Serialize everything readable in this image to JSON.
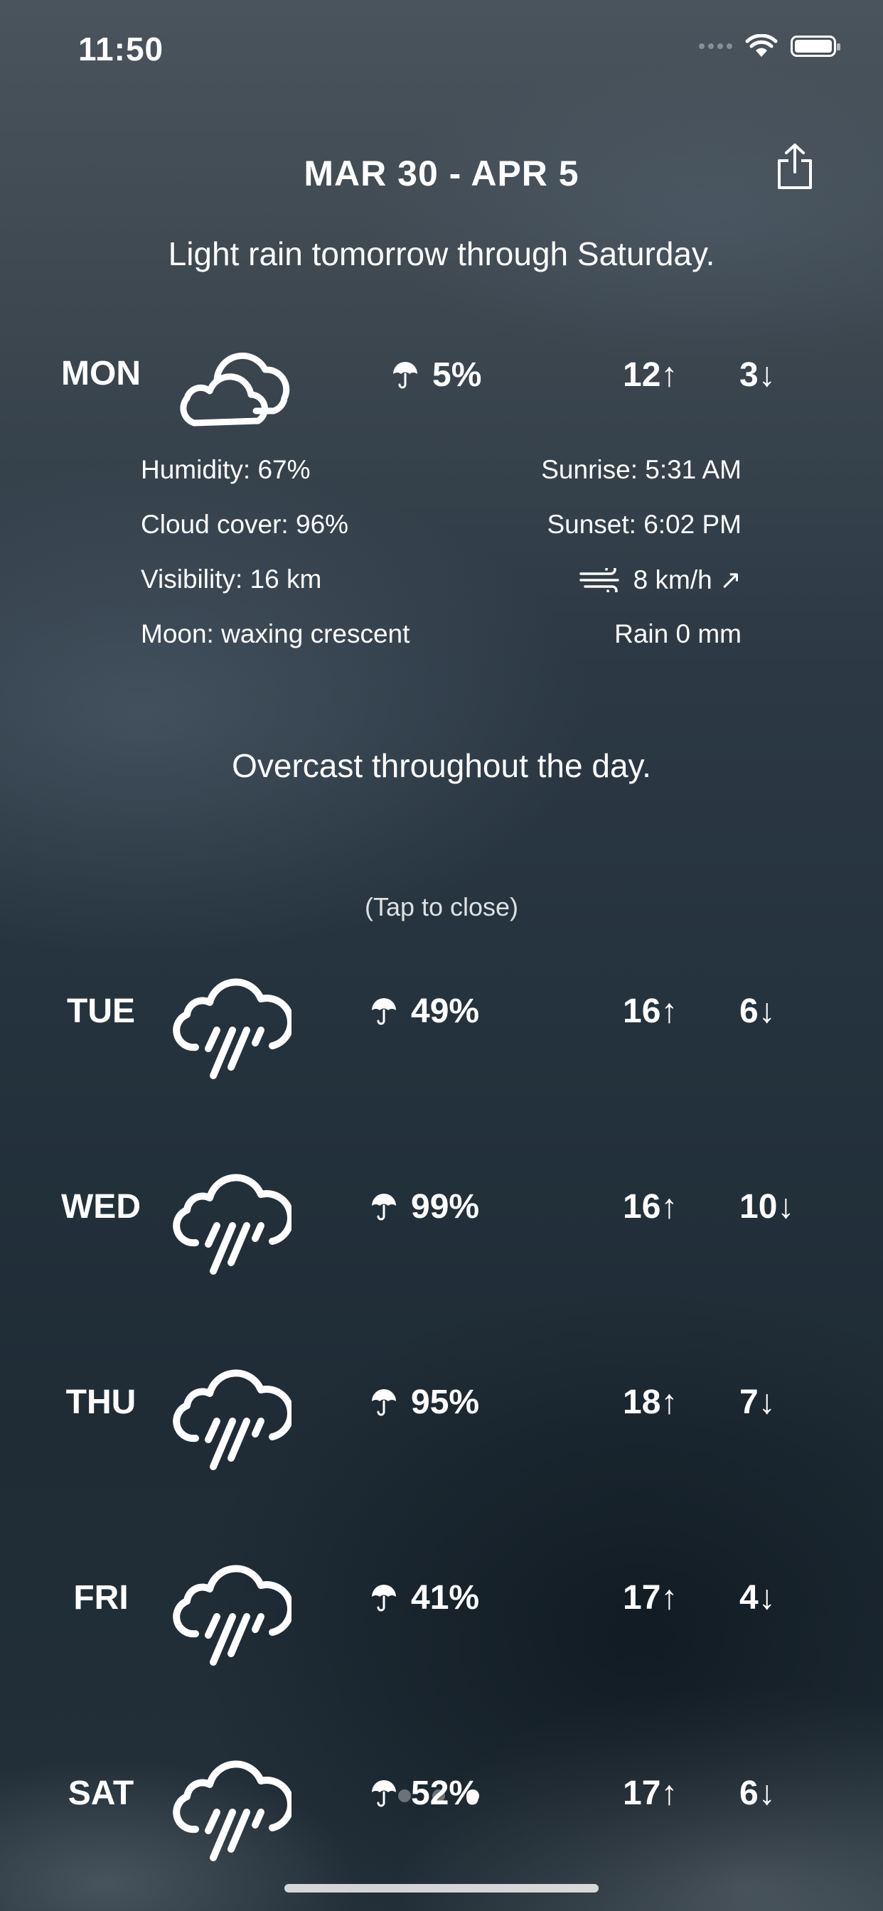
{
  "status": {
    "time": "11:50"
  },
  "header": {
    "date_range": "MAR 30 - APR 5"
  },
  "summary": "Light rain tomorrow through Saturday.",
  "expanded_day": {
    "day": "MON",
    "icon": "cloud-icon",
    "precip": "5%",
    "high": "12↑",
    "low": "3↓",
    "details_left": [
      "Humidity: 67%",
      "Cloud cover: 96%",
      "Visibility: 16 km",
      "Moon: waxing crescent"
    ],
    "details_right": [
      "Sunrise: 5:31 AM",
      "Sunset: 6:02 PM",
      "8 km/h ↗",
      "Rain 0 mm"
    ],
    "day_summary": "Overcast throughout the day.",
    "tap_hint": "(Tap to close)"
  },
  "days": [
    {
      "day": "TUE",
      "icon": "rain-icon",
      "precip": "49%",
      "high": "16↑",
      "low": "6↓"
    },
    {
      "day": "WED",
      "icon": "rain-icon",
      "precip": "99%",
      "high": "16↑",
      "low": "10↓"
    },
    {
      "day": "THU",
      "icon": "rain-icon",
      "precip": "95%",
      "high": "18↑",
      "low": "7↓"
    },
    {
      "day": "FRI",
      "icon": "rain-icon",
      "precip": "41%",
      "high": "17↑",
      "low": "4↓"
    },
    {
      "day": "SAT",
      "icon": "rain-icon",
      "precip": "52%",
      "high": "17↑",
      "low": "6↓"
    }
  ],
  "page_indicator": {
    "pages": 3,
    "current": 3
  }
}
